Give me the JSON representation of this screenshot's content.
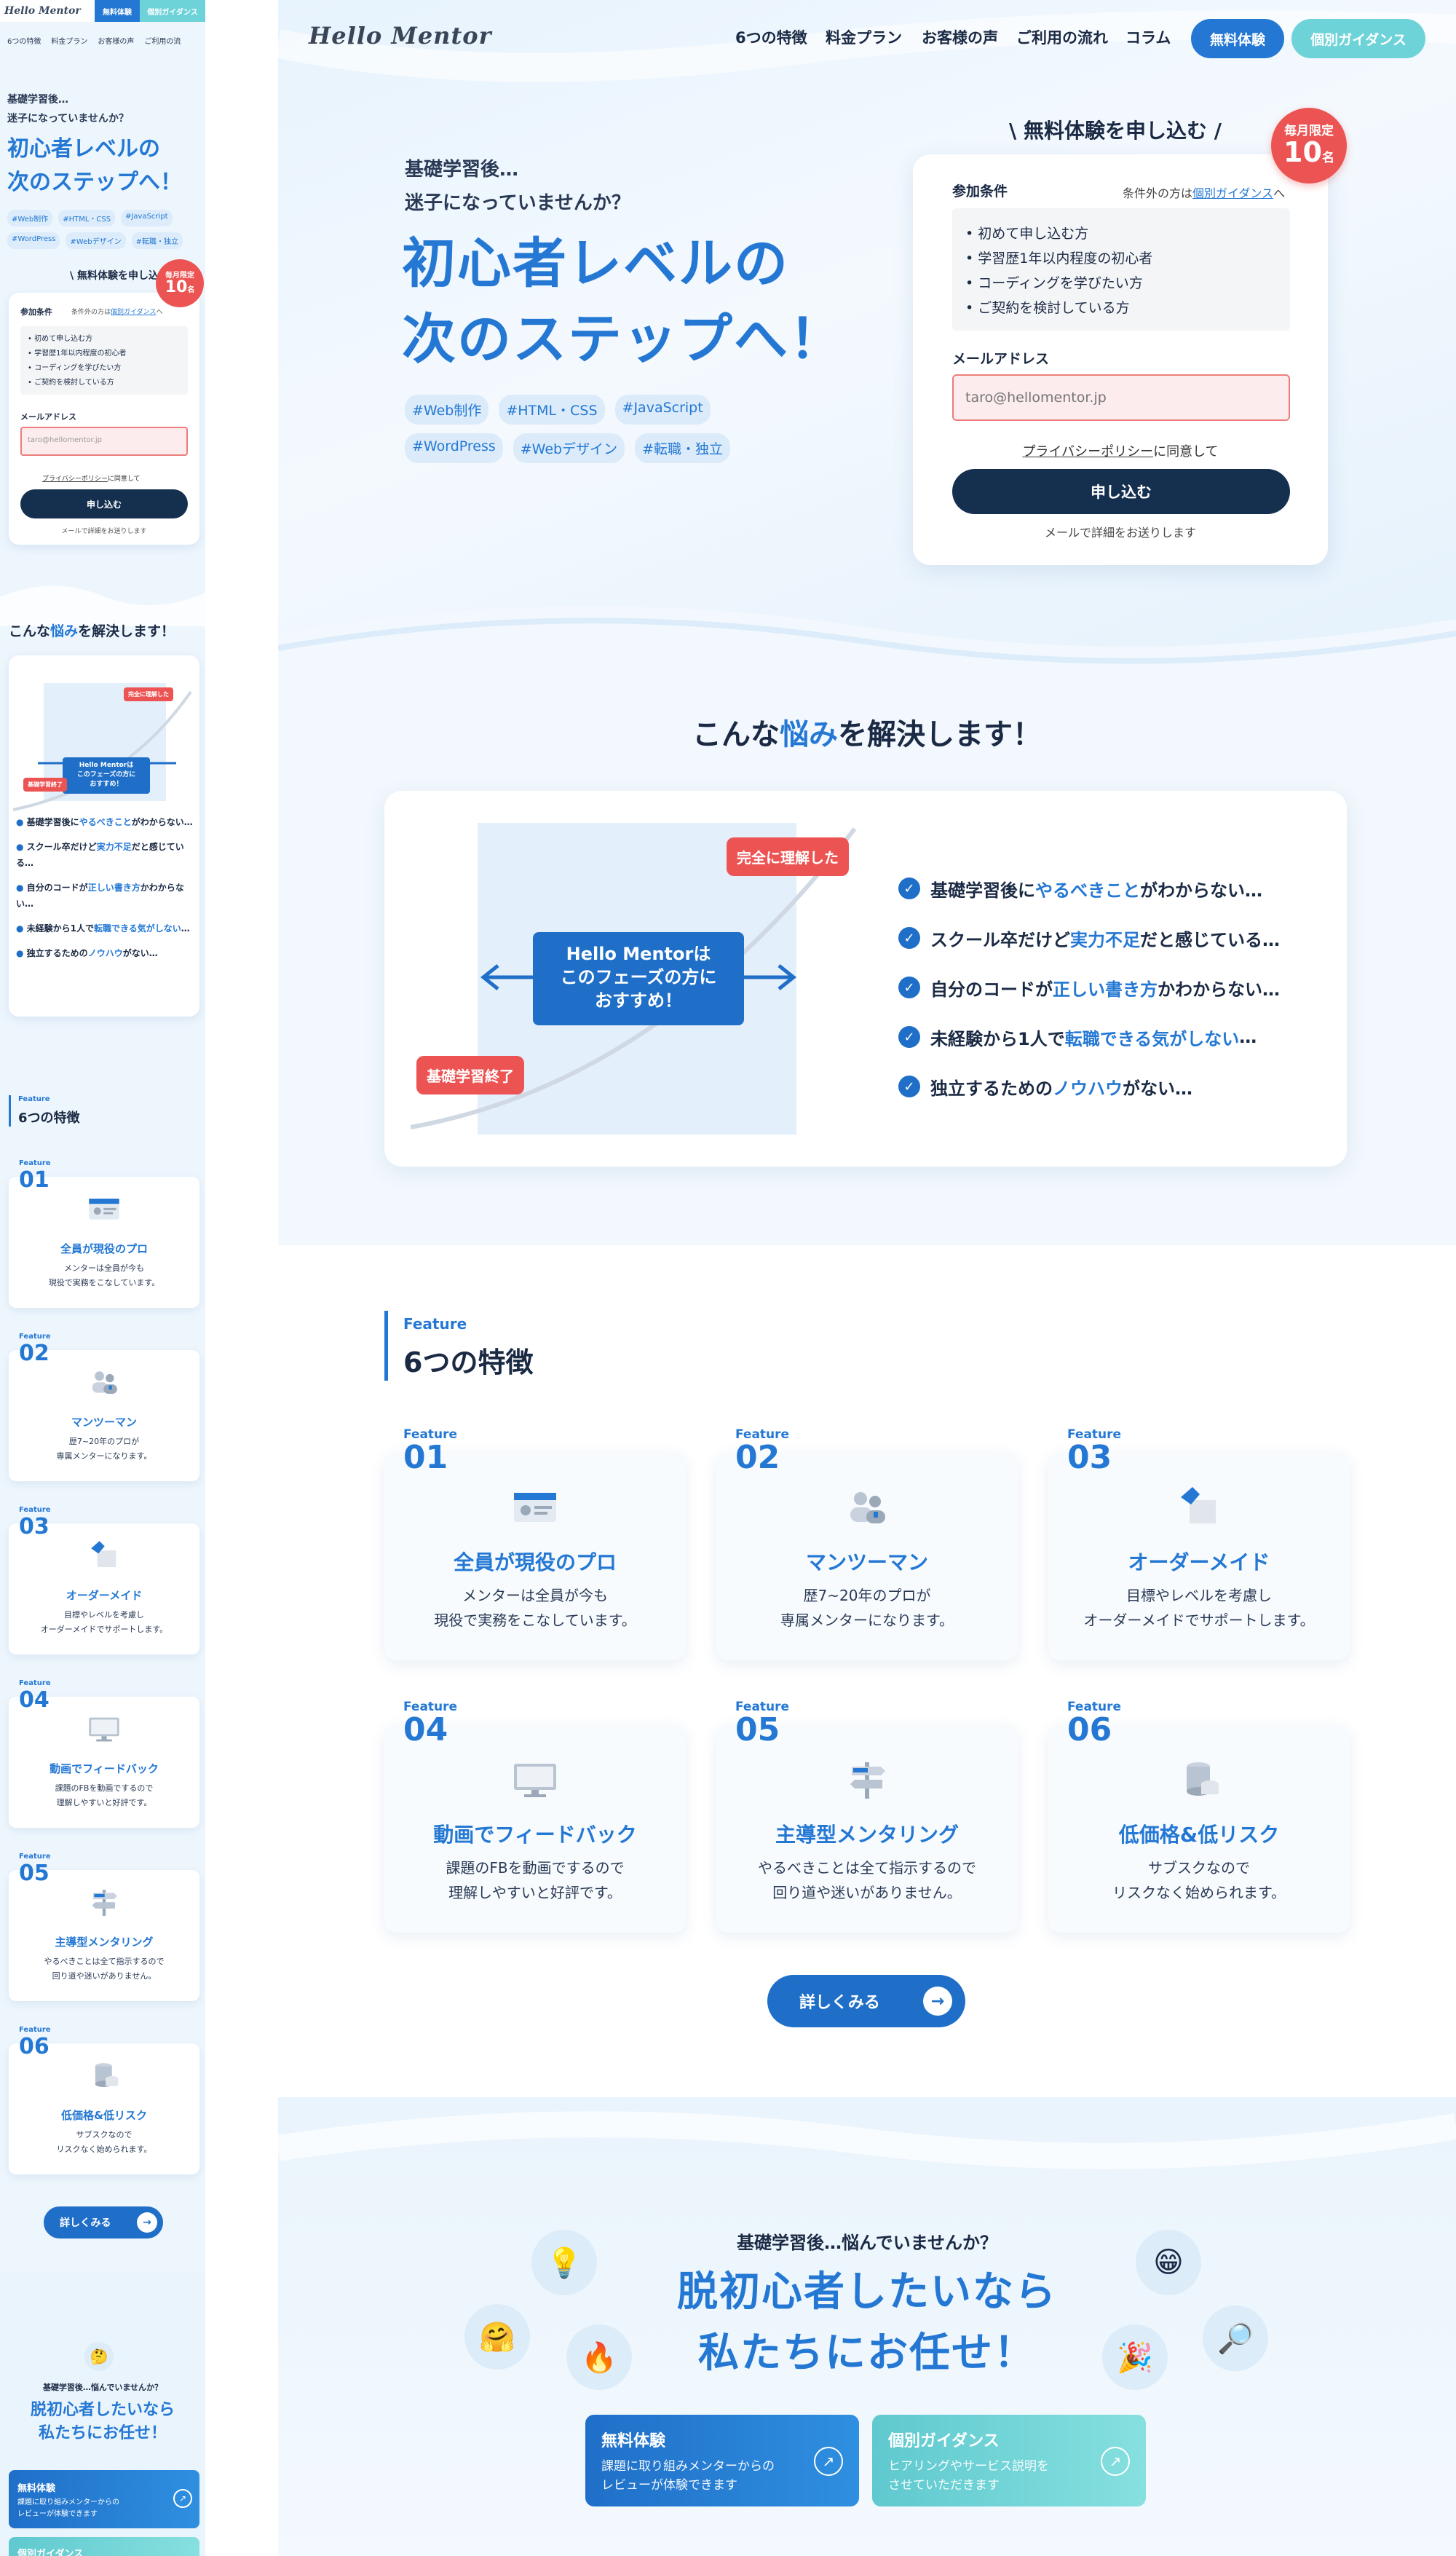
{
  "brand": {
    "logo": "Hello Mentor",
    "blue": "#2478d4",
    "navy": "#152f4f",
    "red": "#ec5453",
    "teal": "#6ed3d8"
  },
  "nav": {
    "items": [
      "6つの特徴",
      "料金プラン",
      "お客様の声",
      "ご利用の流れ",
      "コラム"
    ],
    "trial": "無料体験",
    "guidance": "個別ガイダンス"
  },
  "mobile": {
    "nav": [
      "6つの特徴",
      "料金プラン",
      "お客様の声",
      "ご利用の流"
    ]
  },
  "hero": {
    "lead1": "基礎学習後…",
    "lead2": "迷子になっていませんか？",
    "h1_line1": "初心者レベルの",
    "h1_line2": "次のステップへ！",
    "tags": [
      "#Web制作",
      "#HTML・CSS",
      "#JavaScript",
      "#WordPress",
      "#Webデザイン",
      "#転職・独立"
    ]
  },
  "form": {
    "title": "\\ 無料体験を申し込む /",
    "badge_top": "毎月限定",
    "badge_num": "10",
    "badge_unit": "名",
    "conditions_label": "参加条件",
    "outside_prefix": "条件外の方は",
    "outside_link": "個別ガイダンス",
    "outside_suffix": "へ",
    "conditions": [
      "初めて申し込む方",
      "学習歴1年以内程度の初心者",
      "コーディングを学びたい方",
      "ご契約を検討している方"
    ],
    "email_label": "メールアドレス",
    "email_placeholder": "taro@hellomentor.jp",
    "privacy_link": "プライバシーポリシー",
    "privacy_suffix": "に同意して",
    "submit": "申し込む",
    "note": "メールで詳細をお送りします"
  },
  "problems": {
    "title_pre": "こんな",
    "title_hl": "悩み",
    "title_post": "を解決します！",
    "diagram_box": [
      "Hello Mentorは",
      "このフェーズの方に",
      "おすすめ！"
    ],
    "bubble_start": "基礎学習終了",
    "bubble_end": "完全に理解した",
    "items": [
      {
        "pre": "基礎学習後に",
        "hl": "やるべきこと",
        "post": "がわからない…"
      },
      {
        "pre": "スクール卒だけど",
        "hl": "実力不足",
        "post": "だと感じている…"
      },
      {
        "pre": "自分のコードが",
        "hl": "正しい書き方",
        "post": "かわからない…"
      },
      {
        "pre": "未経験から1人で",
        "hl": "転職できる気がしない",
        "post": "…"
      },
      {
        "pre": "独立するための",
        "hl": "ノウハウ",
        "post": "がない…"
      }
    ]
  },
  "features": {
    "small": "Feature",
    "title": "6つの特徴",
    "items": [
      {
        "label": "Feature",
        "num": "01",
        "title": "全員が現役のプロ",
        "desc1": "メンターは全員が今も",
        "desc2": "現役で実務をこなしています。",
        "icon": "id-card-icon"
      },
      {
        "label": "Feature",
        "num": "02",
        "title": "マンツーマン",
        "desc1": "歴7~20年のプロが",
        "desc2": "専属メンターになります。",
        "icon": "two-people-icon"
      },
      {
        "label": "Feature",
        "num": "03",
        "title": "オーダーメイド",
        "desc1": "目標やレベルを考慮し",
        "desc2": "オーダーメイドでサポートします。",
        "icon": "puzzle-icon"
      },
      {
        "label": "Feature",
        "num": "04",
        "title": "動画でフィードバック",
        "desc1": "課題のFBを動画でするので",
        "desc2": "理解しやすいと好評です。",
        "icon": "monitor-icon"
      },
      {
        "label": "Feature",
        "num": "05",
        "title": "主導型メンタリング",
        "desc1": "やるべきことは全て指示するので",
        "desc2": "回り道や迷いがありません。",
        "icon": "signpost-icon"
      },
      {
        "label": "Feature",
        "num": "06",
        "title": "低価格&低リスク",
        "desc1": "サブスクなので",
        "desc2": "リスクなく始められます。",
        "icon": "coins-icon"
      }
    ],
    "more": "詳しくみる"
  },
  "cta": {
    "lead": "基礎学習後…悩んでいませんか？",
    "h_line1": "脱初心者したいなら",
    "h_line2": "私たちにお任せ！",
    "trial_title": "無料体験",
    "trial_desc1": "課題に取り組みメンターからの",
    "trial_desc2": "レビューが体験できます",
    "guide_title": "個別ガイダンス",
    "guide_desc1": "ヒアリングやサービス説明を",
    "guide_desc2": "させていただきます",
    "emoji": {
      "bulb": "💡",
      "grin": "😁",
      "hug": "🤗",
      "fire": "🔥",
      "party": "🎉",
      "search": "🔎",
      "think": "🤔"
    }
  }
}
